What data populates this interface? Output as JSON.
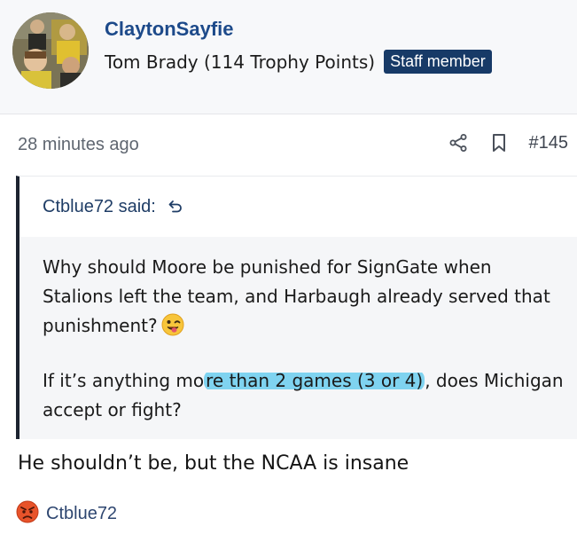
{
  "user": {
    "username": "ClaytonSayfie",
    "title": "Tom Brady (114 Trophy Points)",
    "badge": "Staff member",
    "avatar_icon": "avatar-photo"
  },
  "post": {
    "timestamp": "28 minutes ago",
    "number": "#145",
    "share_icon": "share-icon",
    "bookmark_icon": "bookmark-icon"
  },
  "quote": {
    "author_label": "Ctblue72 said:",
    "jump_icon": "jump-to-quote-icon",
    "paragraph1": "Why should Moore be punished for SignGate when Stalions left the team, and Harbaugh already served that punishment?",
    "paragraph1_emoji": "winking-tongue-emoji",
    "paragraph2_before": "If it’s anything mo",
    "paragraph2_highlighted": "re than 2 games (3 or 4)",
    "paragraph2_after": ", does Michigan accept or fight?",
    "highlight_color": "#7fd3f0"
  },
  "reply": {
    "text": "He shouldn’t be, but the NCAA is insane"
  },
  "reactions": {
    "icon": "angry-face-emoji",
    "users": "Ctblue72"
  },
  "colors": {
    "username": "#1d4a8a",
    "badge_bg": "#173a67",
    "quote_border": "#1c2330",
    "quote_body_bg": "#f5f6f8"
  }
}
